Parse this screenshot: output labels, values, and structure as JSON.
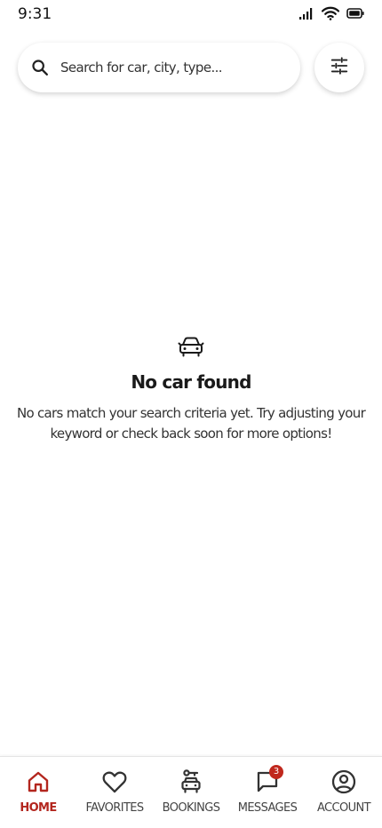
{
  "status_bar": {
    "time": "9:31"
  },
  "search": {
    "placeholder": "Search for car, city, type..."
  },
  "empty_state": {
    "title": "No car found",
    "description": "No cars match your search criteria yet. Try adjusting your keyword or check back soon for more options!"
  },
  "nav": {
    "items": [
      {
        "label": "HOME",
        "icon": "home-icon",
        "active": true
      },
      {
        "label": "FAVORITES",
        "icon": "heart-icon"
      },
      {
        "label": "BOOKINGS",
        "icon": "car-key-icon"
      },
      {
        "label": "MESSAGES",
        "icon": "chat-icon",
        "badge": "3"
      },
      {
        "label": "ACCOUNT",
        "icon": "account-icon"
      }
    ]
  },
  "colors": {
    "accent": "#b3261e",
    "badge": "#c0281d"
  }
}
